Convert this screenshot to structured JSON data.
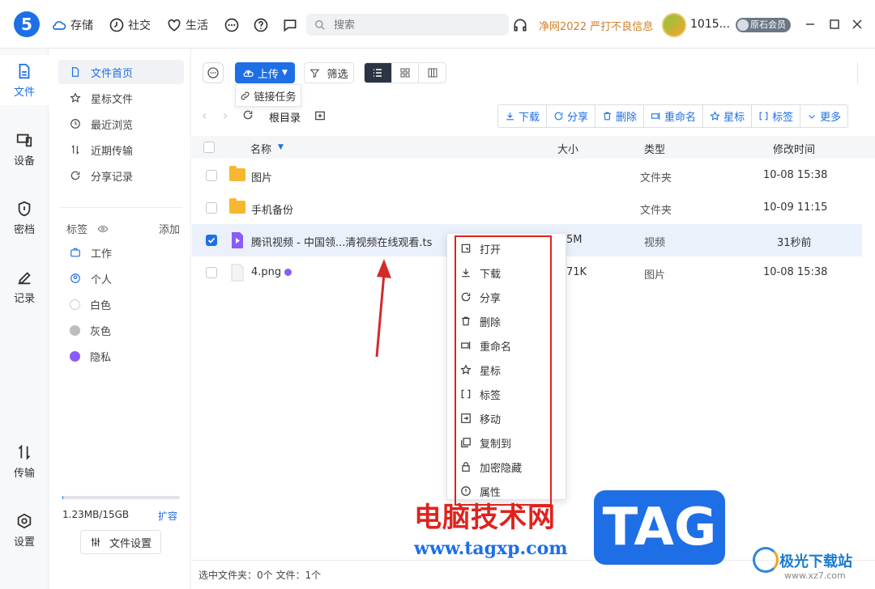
{
  "topbar": {
    "logo": "5",
    "nav": [
      {
        "label": "存储",
        "icon": "cloud-icon"
      },
      {
        "label": "社交",
        "icon": "clock-icon"
      },
      {
        "label": "生活",
        "icon": "heart-icon"
      }
    ],
    "search_placeholder": "搜索",
    "promo": "净网2022 严打不良信息",
    "username": "1015...",
    "vip": "原石会员"
  },
  "leftnav": [
    {
      "label": "文件",
      "icon": "file-icon"
    },
    {
      "label": "设备",
      "icon": "device-icon"
    },
    {
      "label": "密档",
      "icon": "shield-icon"
    },
    {
      "label": "记录",
      "icon": "pen-icon"
    },
    {
      "label": "传输",
      "icon": "transfer-icon"
    },
    {
      "label": "设置",
      "icon": "settings-icon"
    }
  ],
  "sidebar": {
    "items": [
      {
        "label": "文件首页",
        "icon": "file-home-icon"
      },
      {
        "label": "星标文件",
        "icon": "star-icon"
      },
      {
        "label": "最近浏览",
        "icon": "history-icon"
      },
      {
        "label": "近期传输",
        "icon": "transfer-icon"
      },
      {
        "label": "分享记录",
        "icon": "share-icon"
      }
    ],
    "tags_title": "标签",
    "tags_add": "添加",
    "tags": [
      {
        "label": "工作",
        "color": "#1e6fe6"
      },
      {
        "label": "个人",
        "color": "#1e6fe6"
      },
      {
        "label": "白色",
        "color": "#ffffff"
      },
      {
        "label": "灰色",
        "color": "#bdbdbd"
      },
      {
        "label": "隐私",
        "color": "#8b5cf6"
      }
    ],
    "quota_text": "1.23MB/15GB",
    "quota_fraction": 0.0001,
    "expand": "扩容",
    "file_settings": "文件设置"
  },
  "toolbar": {
    "upload": "上传",
    "upload_menu": "链接任务",
    "filter": "筛选",
    "breadcrumb": "根目录",
    "actions": [
      "下载",
      "分享",
      "删除",
      "重命名",
      "星标",
      "标签",
      "更多"
    ]
  },
  "table": {
    "headers": {
      "name": "名称",
      "size": "大小",
      "type": "类型",
      "modified": "修改时间"
    },
    "rows": [
      {
        "name": "图片",
        "size": "",
        "type": "文件夹",
        "modified": "10-08 15:38"
      },
      {
        "name": "手机备份",
        "size": "",
        "type": "文件夹",
        "modified": "10-09 11:15"
      },
      {
        "name": "腾讯视频 - 中国领...清视频在线观看.ts",
        "size": "5M",
        "type": "视频",
        "modified": "31秒前"
      },
      {
        "name": "4.png",
        "size": "71K",
        "type": "图片",
        "modified": "10-08 15:38"
      }
    ]
  },
  "context_menu": [
    "打开",
    "下载",
    "分享",
    "删除",
    "重命名",
    "星标",
    "标签",
    "移动",
    "复制到",
    "加密隐藏",
    "属性"
  ],
  "status": "选中文件夹：0个 文件：1个",
  "watermark": {
    "cn": "电脑技术网",
    "url": "www.tagxp.com",
    "tag": "TAG",
    "site": "极光下载站",
    "site_url": "www.xz7.com"
  },
  "colors": {
    "accent": "#1e6fe6",
    "highlight": "#e0221c",
    "promo": "#d0802a"
  }
}
